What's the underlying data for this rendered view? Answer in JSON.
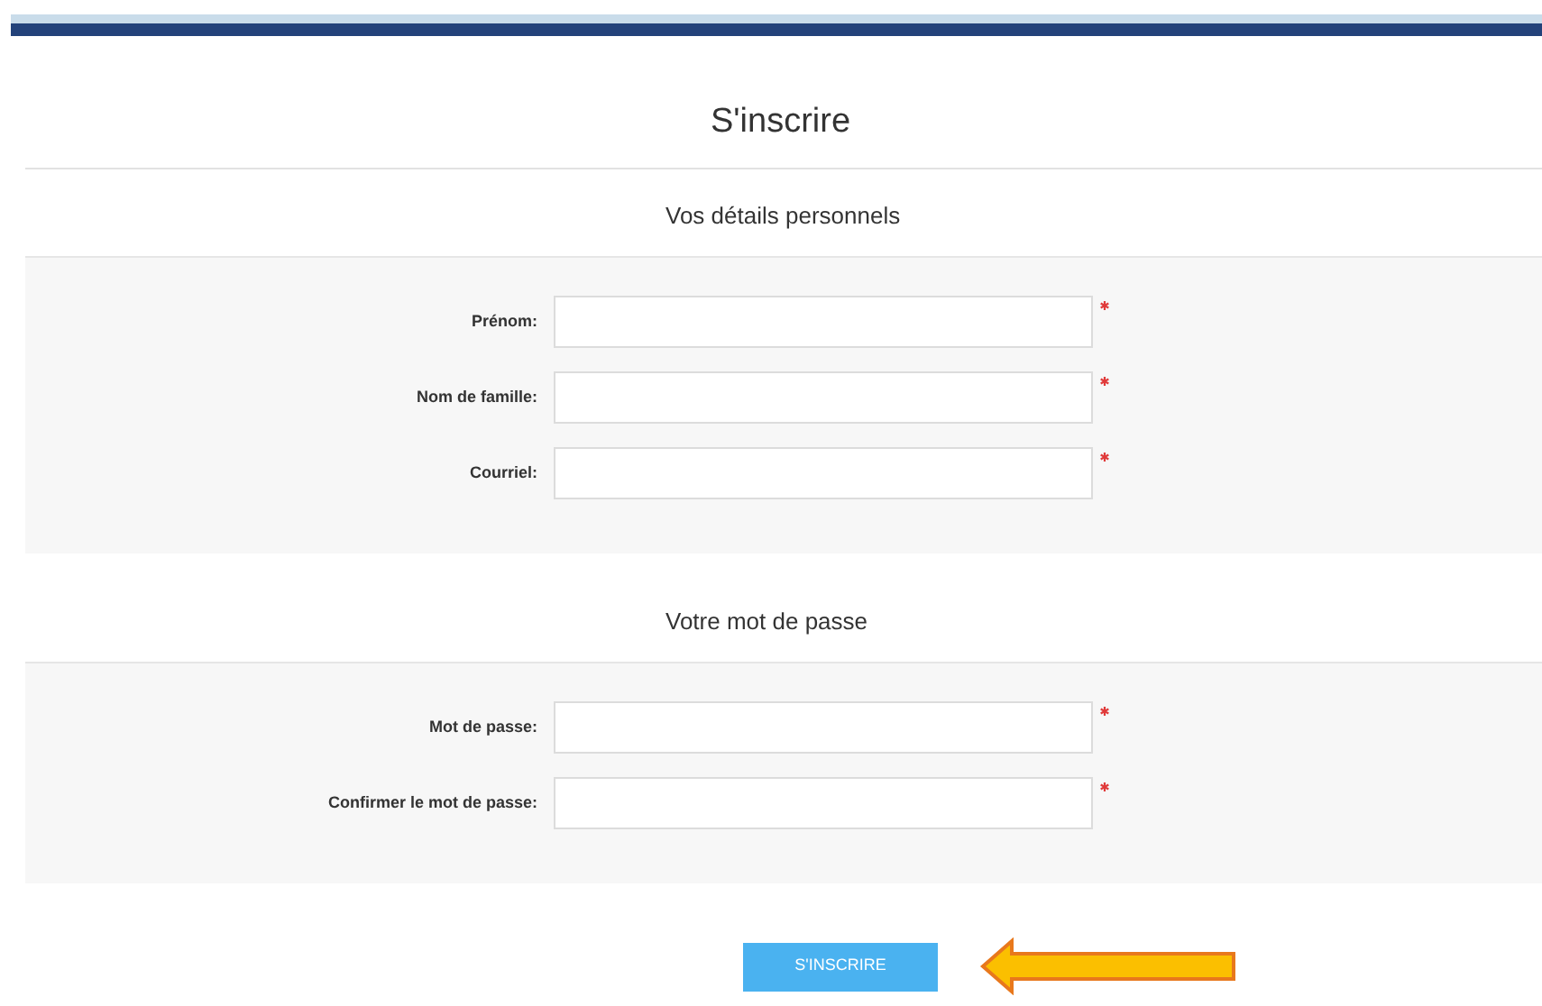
{
  "title": "S'inscrire",
  "sections": [
    {
      "heading": "Vos détails personnels",
      "fields": [
        {
          "label": "Prénom:",
          "required": true
        },
        {
          "label": "Nom de famille:",
          "required": true
        },
        {
          "label": "Courriel:",
          "required": true
        }
      ]
    },
    {
      "heading": "Votre mot de passe",
      "fields": [
        {
          "label": "Mot de passe:",
          "required": true
        },
        {
          "label": "Confirmer le mot de passe:",
          "required": true
        }
      ]
    }
  ],
  "submit_button": "S'INSCRIRE"
}
